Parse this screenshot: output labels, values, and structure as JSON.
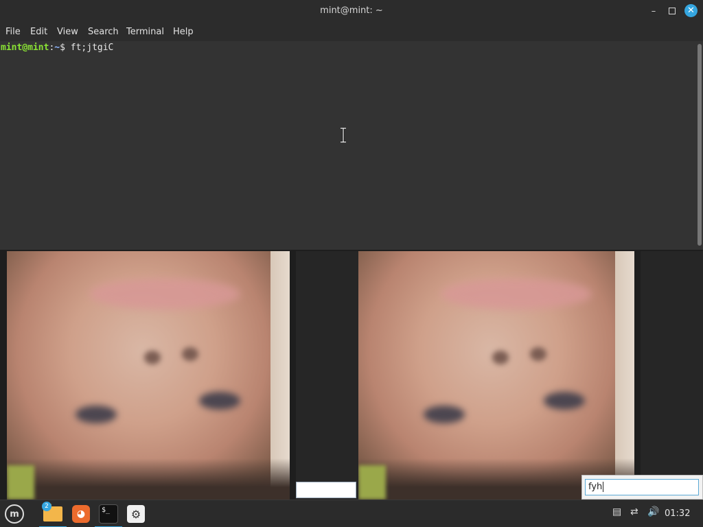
{
  "window": {
    "title": "mint@mint: ~",
    "minimize_glyph": "–",
    "close_glyph": "✕"
  },
  "menu": [
    "File",
    "Edit",
    "View",
    "Search",
    "Terminal",
    "Help"
  ],
  "terminal": {
    "prompt_user": "mint@mint",
    "prompt_sep": ":",
    "prompt_path": "~",
    "prompt_symbol": "$ ",
    "command": "ft;jtgiC"
  },
  "popup": {
    "input_value": "fyh"
  },
  "taskbar": {
    "menu_icon": "mint-menu-icon",
    "files_badge": "2",
    "terminal_glyph": "$_",
    "clock": "01:32"
  },
  "colors": {
    "accent": "#35a6e0",
    "prompt_user": "#8ae234",
    "prompt_path": "#8eb6ff"
  }
}
